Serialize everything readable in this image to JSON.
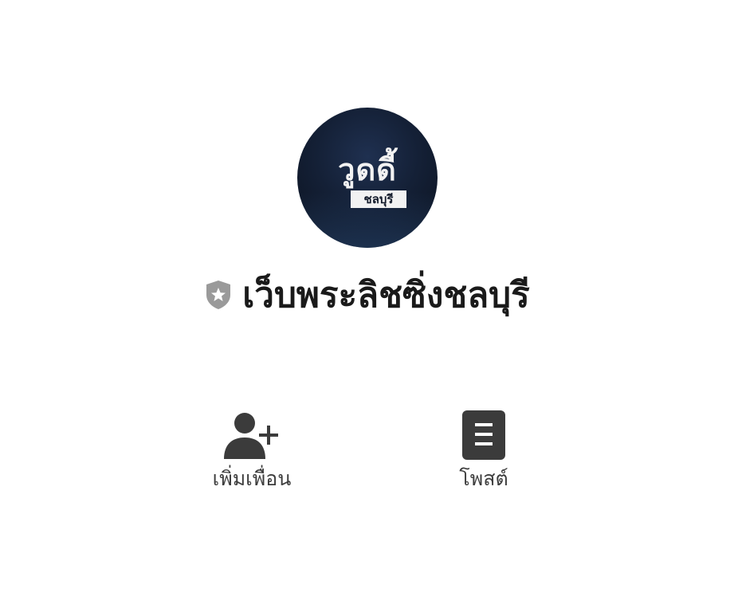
{
  "profile": {
    "avatar_logo_main": "วูดดี้",
    "avatar_logo_sub": "ชลบุรี",
    "account_name": "เว็บพระลิชซิ่งชลบุรี",
    "badge_icon": "shield-star-icon",
    "badge_color": "#9a9a9a"
  },
  "actions": {
    "add_friend": {
      "label": "เพิ่มเพื่อน",
      "icon": "add-person-icon"
    },
    "post": {
      "label": "โพสต์",
      "icon": "document-icon"
    }
  },
  "colors": {
    "icon": "#3b3b3b",
    "text": "#1a1a1a",
    "background": "#ffffff"
  }
}
